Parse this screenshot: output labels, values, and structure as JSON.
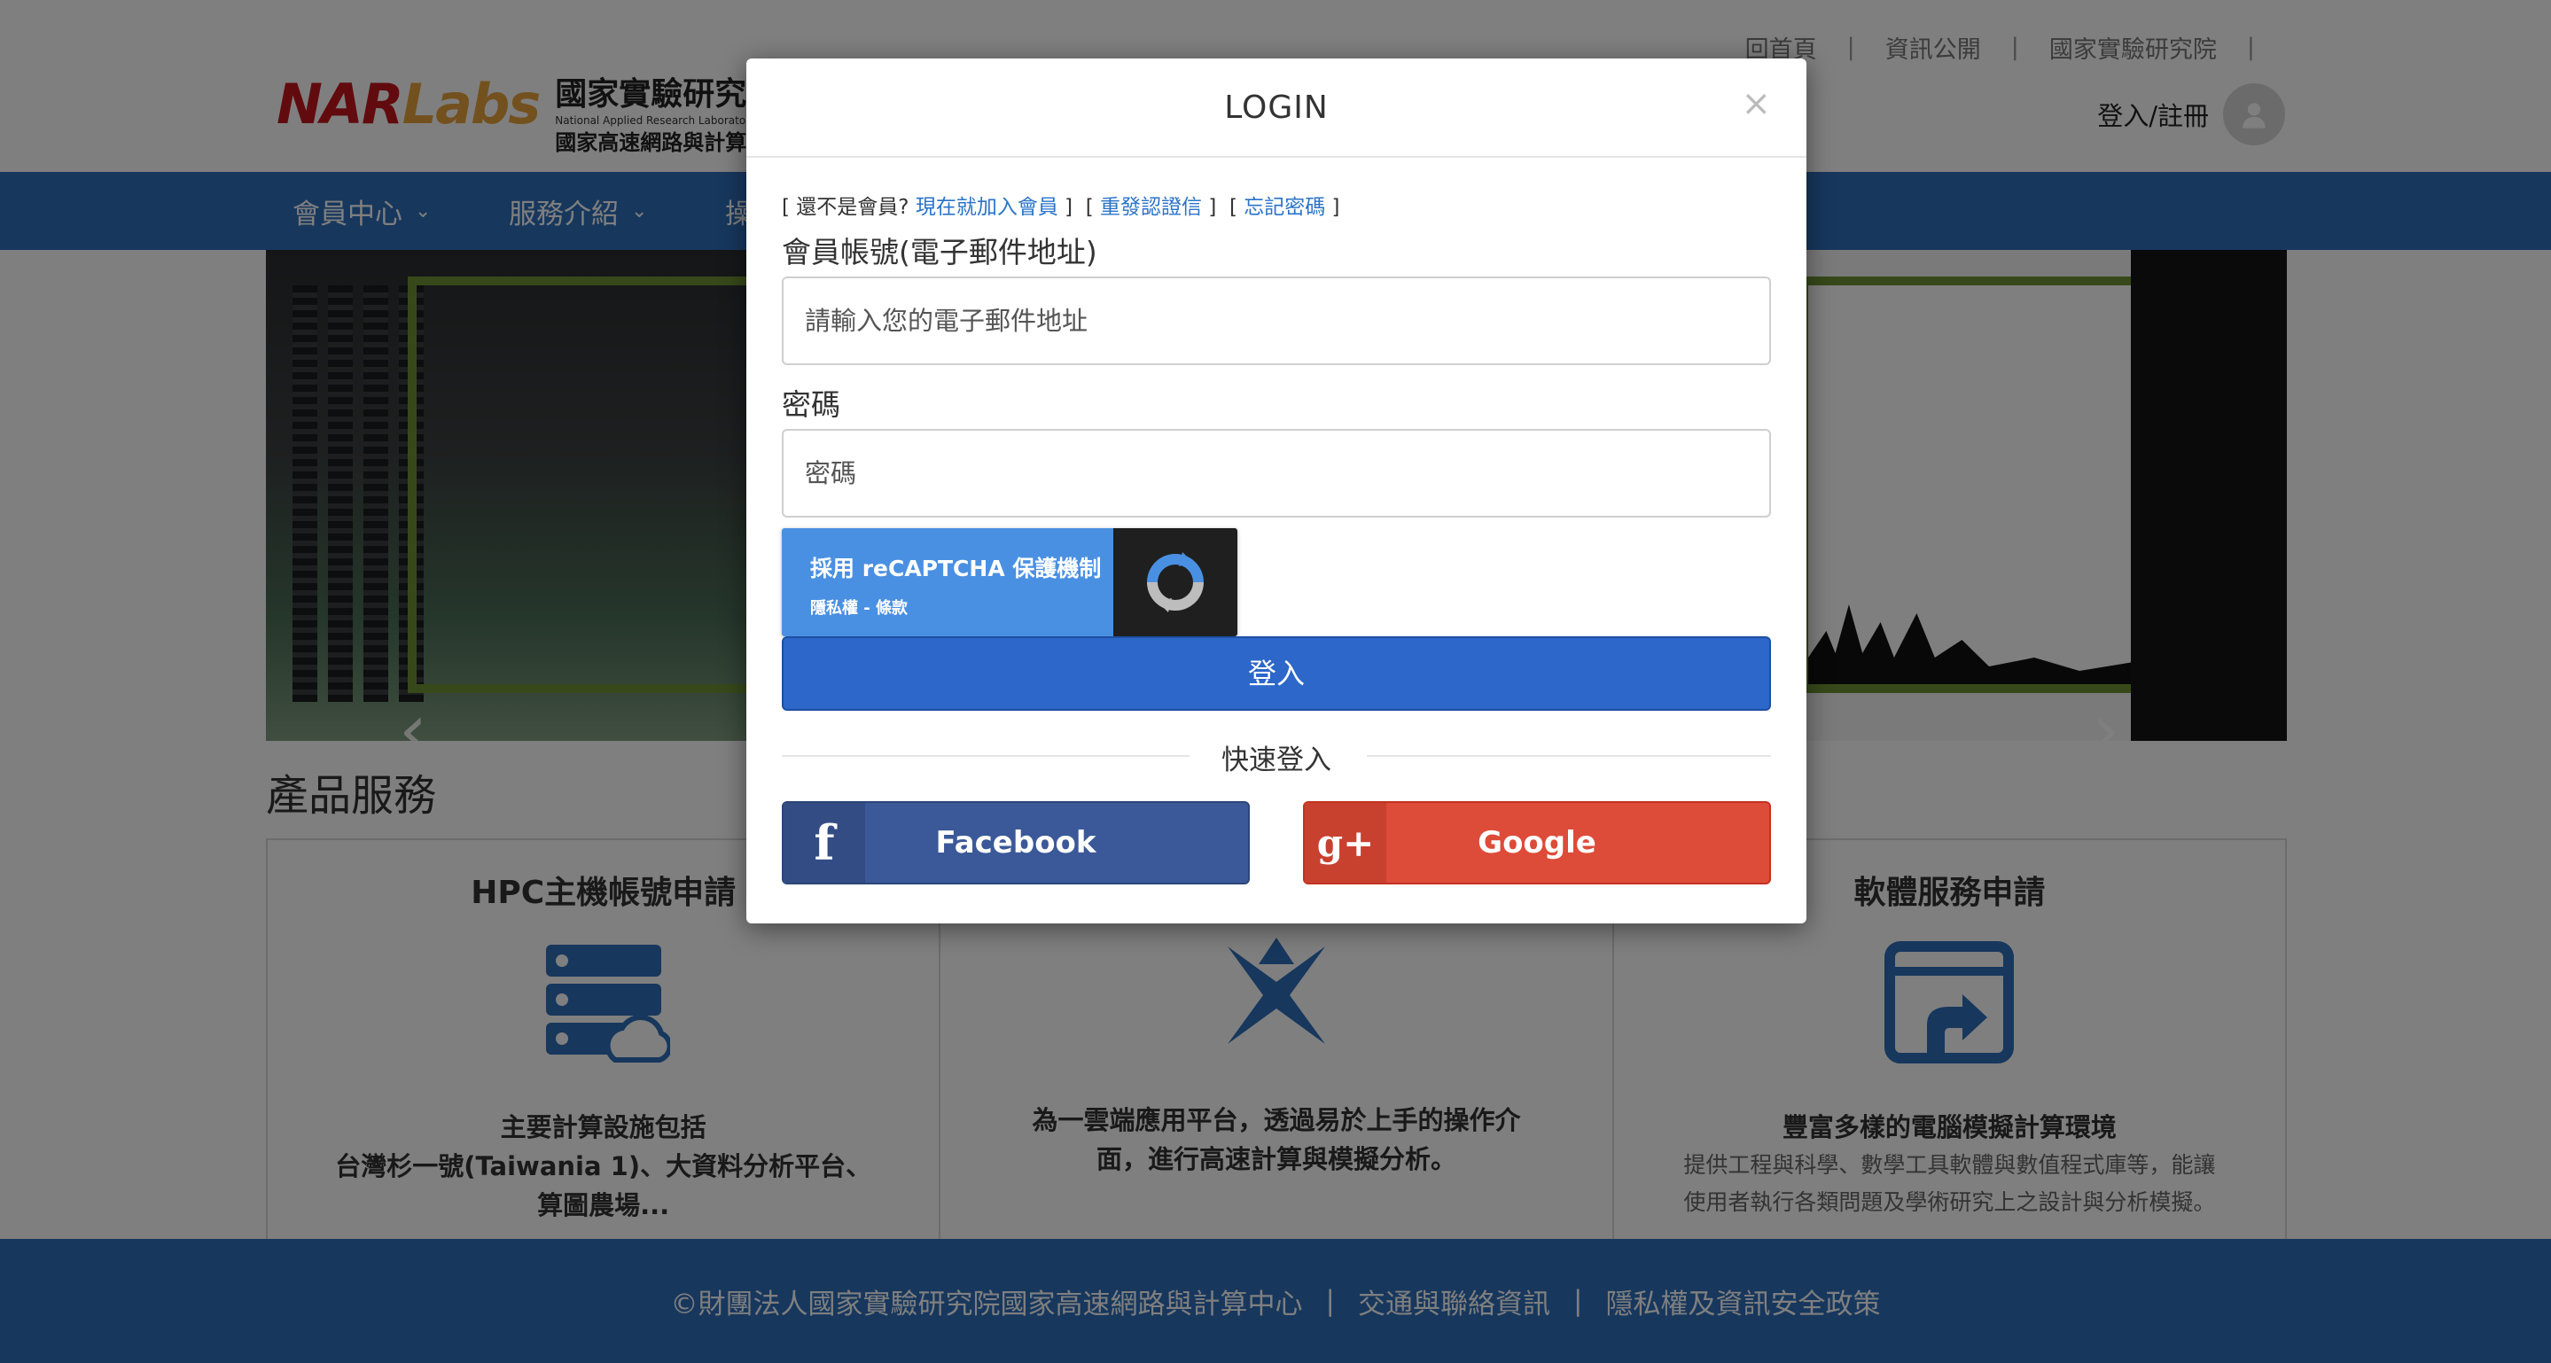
{
  "header": {
    "top_links": [
      "回首頁",
      "資訊公開",
      "國家實驗研究院"
    ],
    "separator": "|",
    "logo": {
      "nar": "NAR",
      "labs": "Labs",
      "cn_name": "國家實驗研究院",
      "en_name": "National Applied Research Laboratories",
      "sub_name": "國家高速網路與計算中心"
    },
    "login_register": "登入/註冊"
  },
  "nav": {
    "items": [
      "會員中心",
      "服務介紹",
      "操"
    ]
  },
  "section": {
    "title": "產品服務"
  },
  "cards": [
    {
      "title": "HPC主機帳號申請",
      "text_lines": [
        "主要計算設施包括",
        "台灣杉一號(Taiwania 1)、大資料分析平台、",
        "算圖農場..."
      ]
    },
    {
      "title": "",
      "text_lines": [
        "為一雲端應用平台，透過易於上手的操作介",
        "面，進行高速計算與模擬分析。"
      ]
    },
    {
      "title": "軟體服務申請",
      "text_lines": [
        "豐富多樣的電腦模擬計算環境"
      ],
      "sub_lines": [
        "提供工程與科學、數學工具軟體與數值程式庫等，能讓",
        "使用者執行各類問題及學術研究上之設計與分析模擬。"
      ]
    }
  ],
  "footer": {
    "copyright": "©財團法人國家實驗研究院國家高速網路與計算中心",
    "separator": "|",
    "traffic": "交通與聯絡資訊",
    "privacy": "隱私權及資訊安全政策"
  },
  "modal": {
    "title": "LOGIN",
    "close": "×",
    "not_member": "還不是會員?",
    "join_now": "現在就加入會員",
    "resend": "重發認證信",
    "forgot": "忘記密碼",
    "account_label": "會員帳號(電子郵件地址)",
    "account_placeholder": "請輸入您的電子郵件地址",
    "password_label": "密碼",
    "password_placeholder": "密碼",
    "recaptcha_main": "採用 reCAPTCHA 保護機制",
    "recaptcha_links": "隱私權 - 條款",
    "login_button": "登入",
    "quick_login": "快速登入",
    "facebook": "Facebook",
    "google": "Google",
    "facebook_icon": "f",
    "google_icon": "g+"
  },
  "colors": {
    "brand_blue": "#2e6fba",
    "login_button": "#2c67c9",
    "facebook": "#3b5998",
    "google": "#dd4b39",
    "link": "#2a73c9",
    "recaptcha": "#4a90e2"
  },
  "icons": [
    "user-avatar-icon",
    "server-cloud-icon",
    "cross-arrows-icon",
    "window-upload-icon",
    "recaptcha-icon",
    "facebook-icon",
    "google-plus-icon",
    "close-icon",
    "chevron-down-icon",
    "chevron-left-icon",
    "chevron-right-icon"
  ]
}
